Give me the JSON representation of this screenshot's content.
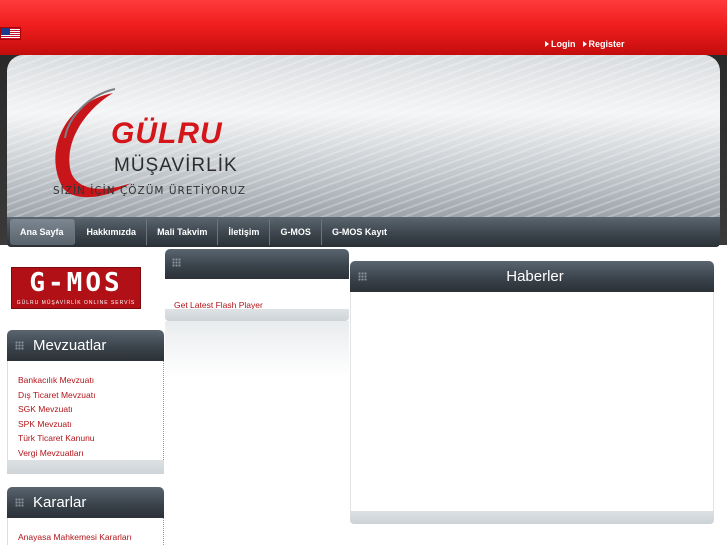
{
  "top": {
    "flag_icon": "us-flag-icon",
    "links": [
      {
        "label": "Login",
        "icon": "arrow-right-icon"
      },
      {
        "label": "Register",
        "icon": "arrow-right-icon"
      }
    ]
  },
  "header": {
    "logo_name": "GÜLRU",
    "logo_sub": "MÜŞAVİRLİK",
    "slogan": "SİZİN İÇİN ÇÖZÜM ÜRETİYORUZ",
    "brand_color": "#d4151a"
  },
  "nav": {
    "items": [
      {
        "label": "Ana Sayfa",
        "active": true
      },
      {
        "label": "Hakkımızda"
      },
      {
        "label": "Mali Takvim"
      },
      {
        "label": "İletişim"
      },
      {
        "label": "G-MOS"
      },
      {
        "label": "G-MOS Kayıt"
      }
    ]
  },
  "gmos_banner": {
    "title": "G-MOS",
    "subtitle": "GÜLRU MÜŞAVİRLİK ONLINE SERVİS"
  },
  "mevzuatlar": {
    "title": "Mevzuatlar",
    "links": [
      "Bankacılık Mevzuatı",
      "Dış Ticaret Mevzuatı",
      "SGK Mevzuatı",
      "SPK Mevzuatı",
      "Türk Ticaret Kanunu",
      "Vergi Mevzuatları"
    ]
  },
  "kararlar": {
    "title": "Kararlar",
    "links": [
      "Anayasa Mahkemesi Kararları"
    ]
  },
  "middle": {
    "title": "",
    "link": "Get Latest Flash Player"
  },
  "haberler": {
    "title": "Haberler"
  }
}
